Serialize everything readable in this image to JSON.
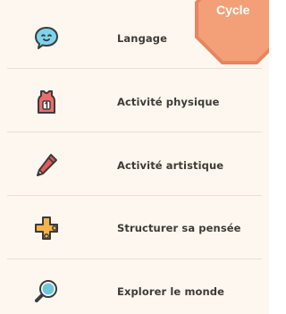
{
  "badge": {
    "label": "Cycle",
    "color": "#f3a078"
  },
  "menu": {
    "items": [
      {
        "label": "Langage",
        "icon": "speech-bubble-icon"
      },
      {
        "label": "Activité physique",
        "icon": "sports-jersey-icon"
      },
      {
        "label": "Activité artistique",
        "icon": "pencil-icon"
      },
      {
        "label": "Structurer sa pensée",
        "icon": "puzzle-plus-icon"
      },
      {
        "label": "Explorer le monde",
        "icon": "magnifier-globe-icon"
      }
    ]
  },
  "colors": {
    "background": "#fdf7ef",
    "text": "#3e3b37",
    "divider": "#e8e0d4",
    "accent": "#e8855f"
  }
}
